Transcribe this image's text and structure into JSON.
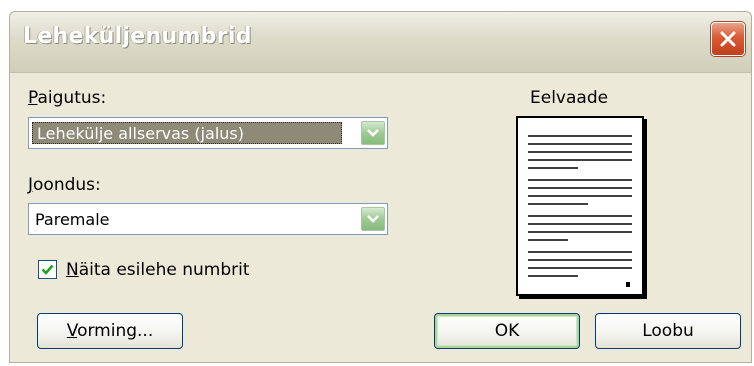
{
  "window": {
    "title": "Leheküljenumbrid"
  },
  "placement": {
    "label_accel": "P",
    "label_rest": "aigutus:",
    "value": "Lehekülje allservas (jalus)"
  },
  "alignment": {
    "label_accel": "J",
    "label_rest": "oondus:",
    "value": "Paremale"
  },
  "show_first_page": {
    "checked": true,
    "label_accel": "N",
    "label_rest": "äita esilehe numbrit"
  },
  "preview": {
    "label": "Eelvaade"
  },
  "buttons": {
    "format_accel": "V",
    "format_rest": "orming...",
    "ok": "OK",
    "cancel": "Loobu"
  },
  "icons": {
    "close": "close-icon",
    "dropdown": "chevron-down-icon",
    "check": "checkmark-icon"
  },
  "colors": {
    "title_close": "#d95b35",
    "dropdown_green": "#9fca95",
    "selection": "#8e8a77",
    "dialog_bg": "#ece9d8"
  }
}
